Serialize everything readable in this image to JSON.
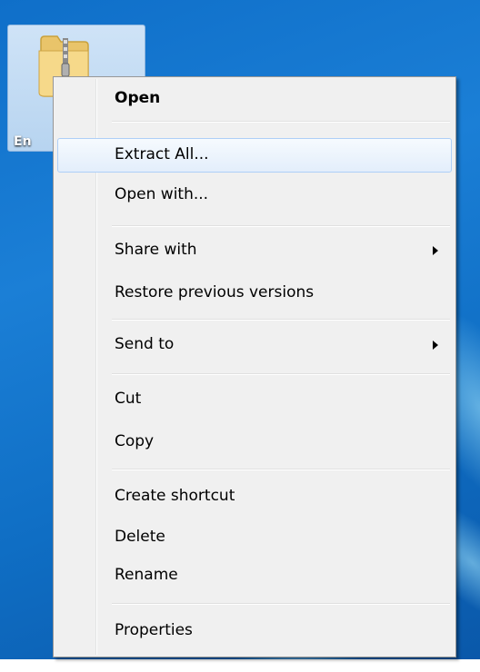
{
  "desktop": {
    "icon_label": "En",
    "icon_name": "zip-folder-icon"
  },
  "context_menu": {
    "items": [
      {
        "label": "Open",
        "bold": true
      },
      {
        "label": "Extract All...",
        "highlighted": true
      },
      {
        "label": "Open with..."
      },
      {
        "label": "Share with",
        "submenu": true
      },
      {
        "label": "Restore previous versions"
      },
      {
        "label": "Send to",
        "submenu": true
      },
      {
        "label": "Cut"
      },
      {
        "label": "Copy"
      },
      {
        "label": "Create shortcut"
      },
      {
        "label": "Delete"
      },
      {
        "label": "Rename"
      },
      {
        "label": "Properties"
      }
    ],
    "colors": {
      "menu_background": "#f0f0f0",
      "highlight_border": "#aecff7",
      "highlight_fill": "#e3eefb"
    }
  }
}
